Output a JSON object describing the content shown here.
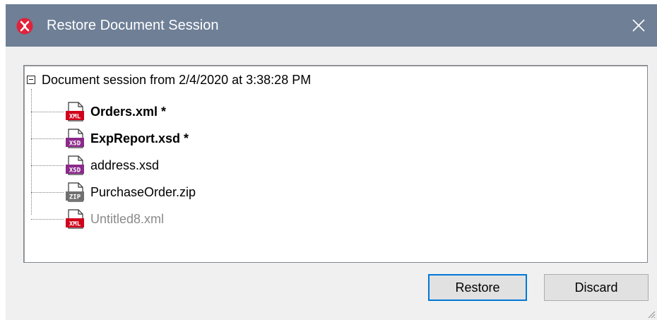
{
  "window": {
    "title": "Restore Document Session",
    "icon": "altova-app-icon",
    "close_icon": "close-icon"
  },
  "session": {
    "root_label": "Document session from 2/4/2020 at 3:38:28 PM",
    "files": [
      {
        "name": "Orders.xml *",
        "type": "XML",
        "modified": true
      },
      {
        "name": "ExpReport.xsd *",
        "type": "XSD",
        "modified": true
      },
      {
        "name": "address.xsd",
        "type": "XSD",
        "modified": false
      },
      {
        "name": "PurchaseOrder.zip",
        "type": "ZIP",
        "modified": false
      },
      {
        "name": "Untitled8.xml",
        "type": "XML",
        "modified": false,
        "dimmed": true
      }
    ]
  },
  "buttons": {
    "restore": "Restore",
    "discard": "Discard"
  },
  "colors": {
    "titlebar": "#6e7f96",
    "xml_icon": "#d0021b",
    "xsd_icon": "#8b2a8b",
    "zip_icon": "#707070",
    "default_button_border": "#0078d7"
  }
}
